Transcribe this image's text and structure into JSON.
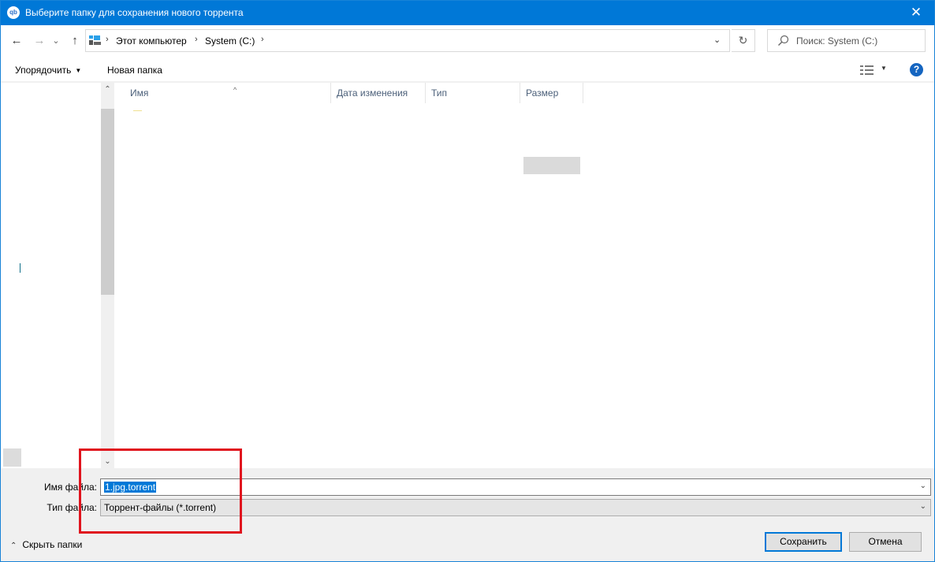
{
  "window": {
    "title": "Выберите папку для сохранения нового торрента",
    "app_icon_text": "qb",
    "close_glyph": "✕"
  },
  "nav": {
    "back_glyph": "←",
    "forward_glyph": "→",
    "recent_glyph": "⌄",
    "up_glyph": "↑"
  },
  "address": {
    "icon": "computer-icon",
    "crumbs": [
      "Этот компьютер",
      "System (C:)"
    ],
    "separator": "›",
    "dropdown_glyph": "⌄",
    "refresh_glyph": "↻"
  },
  "search": {
    "placeholder": "Поиск: System (C:)",
    "icon": "search-icon"
  },
  "toolbar": {
    "organize_label": "Упорядочить",
    "organize_arrow": "▼",
    "new_folder_label": "Новая папка",
    "view_icon": "details-view-icon",
    "view_arrow": "▼",
    "help_label": "?"
  },
  "scrollbar": {
    "up_glyph": "⌃",
    "down_glyph": "⌄"
  },
  "columns": {
    "sort_glyph": "^",
    "headers": [
      "Имя",
      "Дата изменения",
      "Тип",
      "Размер"
    ]
  },
  "form": {
    "filename_label": "Имя файла:",
    "filename_value": "1.jpg.torrent",
    "filetype_label": "Тип файла:",
    "filetype_value": "Торрент-файлы (*.torrent)",
    "dropdown_glyph": "⌄"
  },
  "footer": {
    "hide_folders_chevron": "⌃",
    "hide_folders_label": "Скрыть папки",
    "save_label": "Сохранить",
    "cancel_label": "Отмена"
  },
  "colors": {
    "titlebar": "#0078d7",
    "highlight": "#e0141e",
    "selection": "#0078d7"
  }
}
